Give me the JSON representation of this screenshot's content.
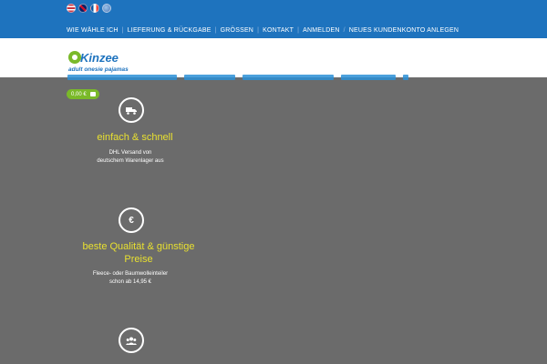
{
  "topbar": {
    "flags": [
      "us-flag-icon",
      "uk-flag-icon",
      "fr-flag-icon",
      "world-flag-icon"
    ],
    "nav": [
      {
        "label": "WIE WÄHLE ICH"
      },
      {
        "label": "LIEFERUNG & RÜCKGABE"
      },
      {
        "label": "GRÖSSEN"
      },
      {
        "label": "KONTAKT"
      },
      {
        "label": "ANMELDEN"
      },
      {
        "label": "NEUES KUNDENKONTO ANLEGEN"
      }
    ]
  },
  "logo": {
    "name": "Kinzee",
    "tagline": "adult onesie pajamas"
  },
  "cart": {
    "amount": "0,00 €"
  },
  "features": [
    {
      "icon": "truck-icon",
      "title": "einfach & schnell",
      "line1": "DHL Versand von",
      "line2": "deutschem Warenlager aus"
    },
    {
      "icon": "euro-icon",
      "title_line1": "beste Qualität & günstige",
      "title_line2": "Preise",
      "line1": "Fleece- oder Baumwolleinteiler",
      "line2": "schon ab 14,95 €"
    },
    {
      "icon": "group-icon"
    }
  ],
  "colors": {
    "topbar": "#1e73be",
    "background": "#6b6b6b",
    "accent_yellow": "#e8e030",
    "cart_green": "#7ab929"
  }
}
